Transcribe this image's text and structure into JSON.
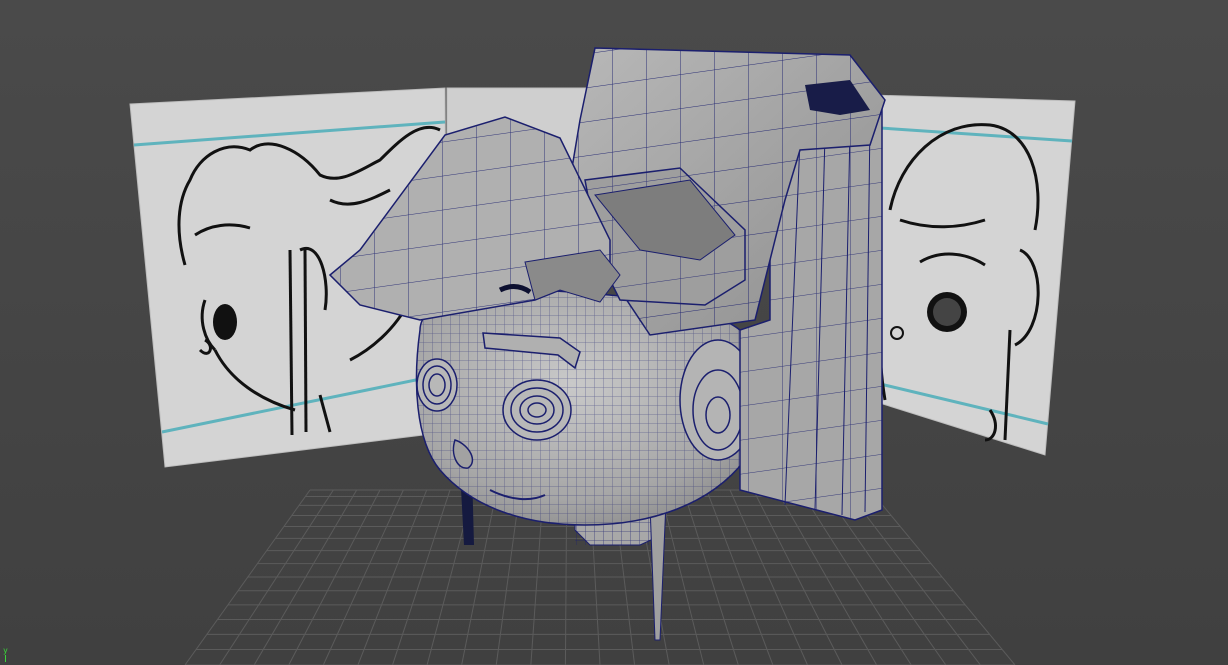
{
  "viewport": {
    "background_color": "#464646",
    "grid_color": "#5b5b5b",
    "wire_color": "#1b1f6e",
    "model_color": "#a9a9a9",
    "image_plane_color": "#d7d7d7",
    "guide_line_color": "#5fb3bd"
  },
  "axis_gizmo": {
    "label": "y",
    "color": "#39d639"
  }
}
